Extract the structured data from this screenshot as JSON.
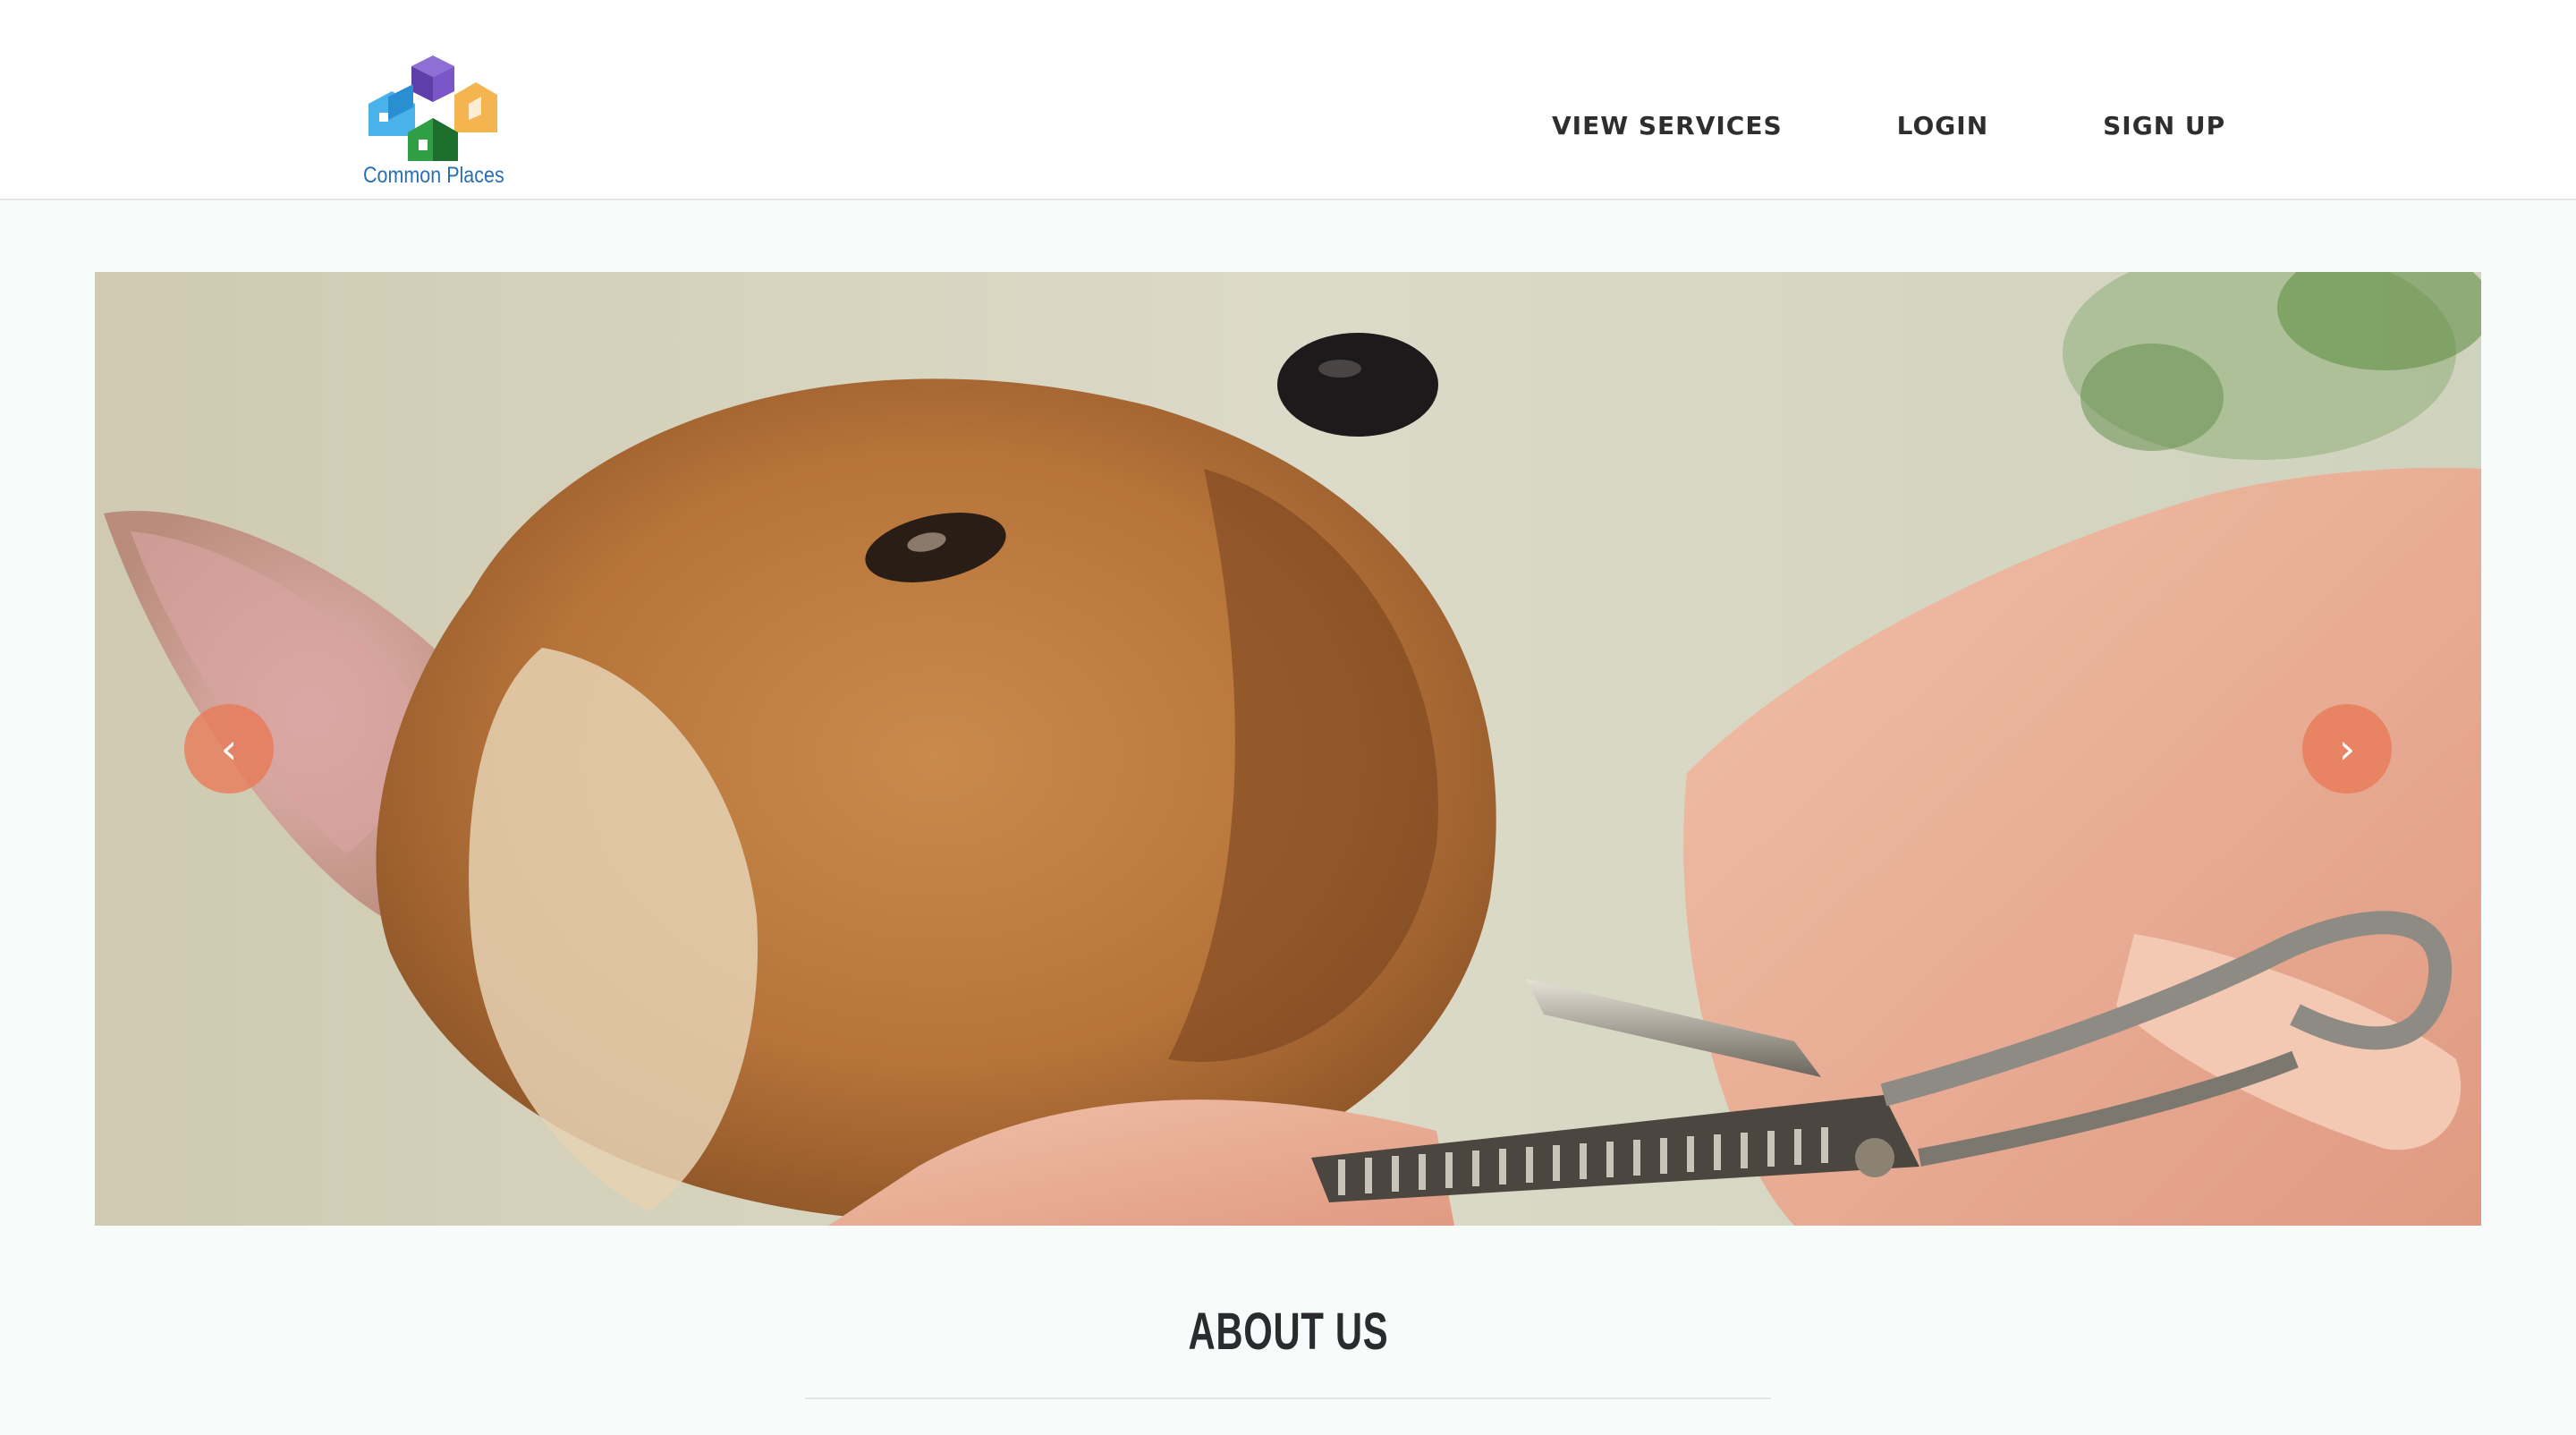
{
  "brand": {
    "name": "Common Places",
    "logo_icon": "stacked-houses-logo",
    "colors": [
      "#6f4fb8",
      "#3aa6e0",
      "#f2b24a",
      "#2f9a3f",
      "#1f6b2c"
    ]
  },
  "nav": {
    "items": [
      {
        "label": "VIEW SERVICES"
      },
      {
        "label": "LOGIN"
      },
      {
        "label": "SIGN UP"
      }
    ]
  },
  "carousel": {
    "slide_image": "dog-grooming-scissors-photo",
    "prev_icon": "chevron-left-icon",
    "next_icon": "chevron-right-icon",
    "control_color": "#e87856",
    "prev_glyph": "‹",
    "next_glyph": "›"
  },
  "about": {
    "heading": "ABOUT US"
  }
}
